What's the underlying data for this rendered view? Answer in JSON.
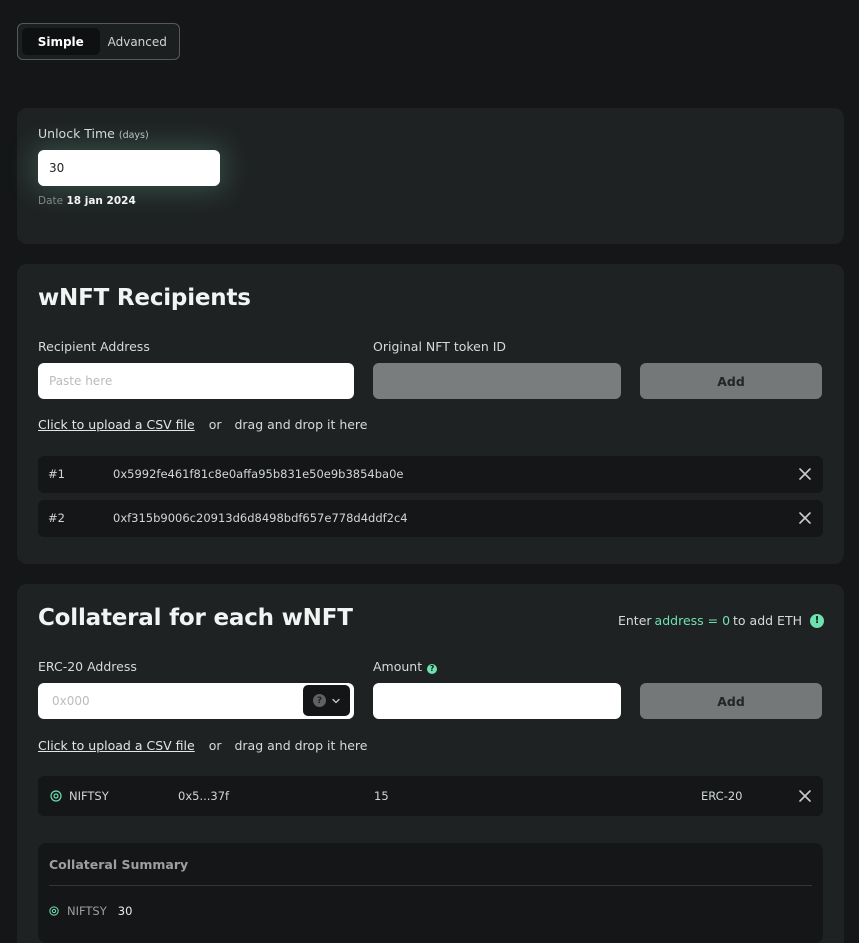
{
  "mode_switch": {
    "simple": "Simple",
    "advanced": "Advanced",
    "active": "Simple"
  },
  "unlock": {
    "label": "Unlock Time",
    "unit": "(days)",
    "value": "30",
    "date_label": "Date",
    "date_value": "18 jan 2024"
  },
  "recipients": {
    "title": "wNFT Recipients",
    "address_label": "Recipient Address",
    "address_placeholder": "Paste here",
    "token_id_label": "Original NFT token ID",
    "add_label": "Add",
    "upload_link": "Click to upload a CSV file",
    "upload_or": "or",
    "upload_drag": "drag and drop it here",
    "items": [
      {
        "index": "#1",
        "address": "0x5992fe461f81c8e0affa95b831e50e9b3854ba0e"
      },
      {
        "index": "#2",
        "address": "0xf315b9006c20913d6d8498bdf657e778d4ddf2c4"
      }
    ]
  },
  "collateral": {
    "title": "Collateral for each wNFT",
    "hint_prefix": "Enter",
    "hint_accent": "address = 0",
    "hint_suffix": "to add ETH",
    "erc20_label": "ERC-20 Address",
    "erc20_placeholder": "0x000",
    "amount_label": "Amount",
    "add_label": "Add",
    "upload_link": "Click to upload a CSV file",
    "upload_or": "or",
    "upload_drag": "drag and drop it here",
    "items": [
      {
        "token": "NIFTSY",
        "address": "0x5...37f",
        "amount": "15",
        "standard": "ERC-20"
      }
    ],
    "summary": {
      "title": "Collateral Summary",
      "items": [
        {
          "token": "NIFTSY",
          "amount": "30"
        }
      ]
    }
  },
  "colors": {
    "accent": "#6fe0b0",
    "background": "#141617",
    "card": "#1f2223"
  }
}
